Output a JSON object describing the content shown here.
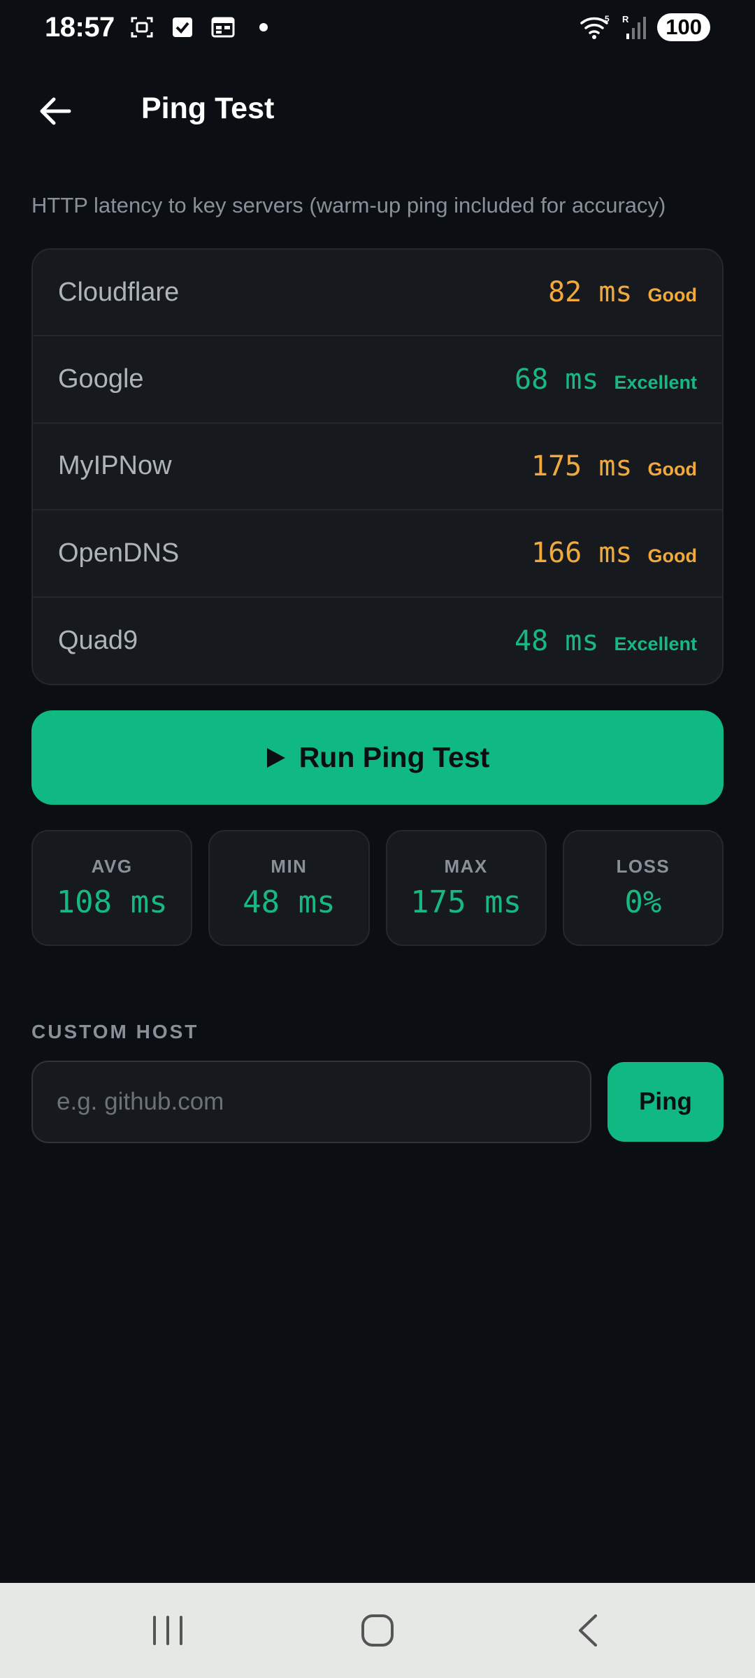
{
  "status_bar": {
    "time": "18:57",
    "battery": "100",
    "icons": [
      "screenshot-icon",
      "checkbox-icon",
      "calendar-icon",
      "dot-icon",
      "wifi-icon",
      "signal-icon"
    ]
  },
  "header": {
    "title": "Ping Test",
    "back_icon": "arrow-left-icon"
  },
  "subtitle": "HTTP latency to key servers (warm-up ping included for accuracy)",
  "servers": [
    {
      "name": "Cloudflare",
      "ms": "82 ms",
      "rating": "Good"
    },
    {
      "name": "Google",
      "ms": "68 ms",
      "rating": "Excellent"
    },
    {
      "name": "MyIPNow",
      "ms": "175 ms",
      "rating": "Good"
    },
    {
      "name": "OpenDNS",
      "ms": "166 ms",
      "rating": "Good"
    },
    {
      "name": "Quad9",
      "ms": "48 ms",
      "rating": "Excellent"
    }
  ],
  "run_button": {
    "icon": "play-icon",
    "label": "Run Ping Test"
  },
  "stats": [
    {
      "label": "AVG",
      "value": "108 ms"
    },
    {
      "label": "MIN",
      "value": "48 ms"
    },
    {
      "label": "MAX",
      "value": "175 ms"
    },
    {
      "label": "LOSS",
      "value": "0%"
    }
  ],
  "custom_host": {
    "section_label": "CUSTOM HOST",
    "placeholder": "e.g. github.com",
    "value": "",
    "button_label": "Ping"
  },
  "colors": {
    "background": "#0b0f14",
    "card": "#161a1e",
    "accent": "#10b981",
    "good": "#f2a93b",
    "excellent": "#17b981"
  }
}
